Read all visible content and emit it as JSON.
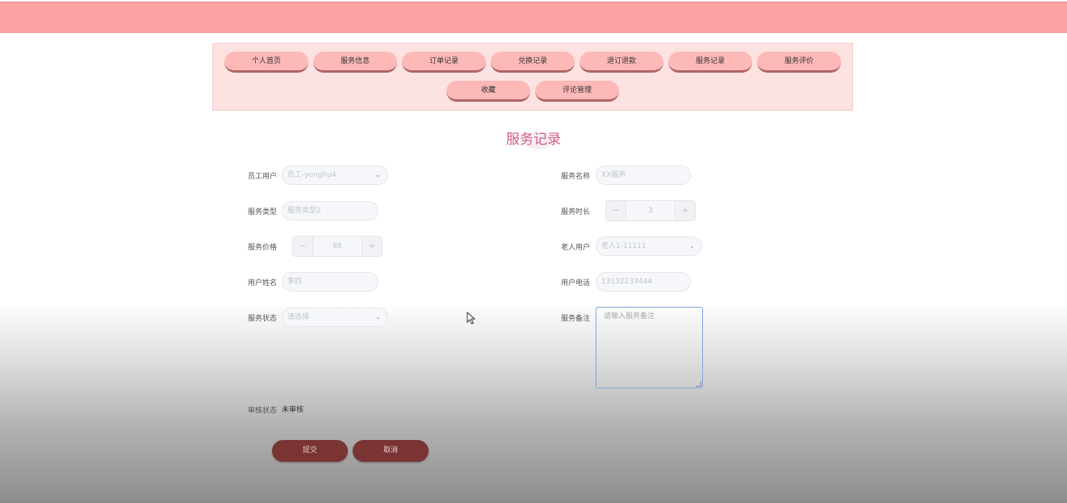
{
  "nav": {
    "items": [
      "个人首页",
      "服务信息",
      "订单记录",
      "兑换记录",
      "退订退款",
      "服务记录",
      "服务评价",
      "收藏",
      "评论管理"
    ]
  },
  "page": {
    "title": "服务记录"
  },
  "form": {
    "employee_user": {
      "label": "员工用户",
      "value": "员工-yonghu4"
    },
    "service_name": {
      "label": "服务名称",
      "placeholder": "XX服务"
    },
    "service_type": {
      "label": "服务类型",
      "placeholder": "服务类型2"
    },
    "service_duration": {
      "label": "服务时长",
      "value": "3",
      "minus": "−",
      "plus": "+"
    },
    "service_price": {
      "label": "服务价格",
      "value": "88",
      "minus": "−",
      "plus": "+"
    },
    "elder_user": {
      "label": "老人用户",
      "value": "老人1-11111"
    },
    "user_name": {
      "label": "用户姓名",
      "placeholder": "李四"
    },
    "user_phone": {
      "label": "用户电话",
      "placeholder": "13132233444"
    },
    "service_status": {
      "label": "服务状态",
      "placeholder": "请选择"
    },
    "service_note": {
      "label": "服务备注",
      "placeholder": "请输入服务备注"
    },
    "review_status": {
      "label": "审核状态",
      "value": "未审核"
    }
  },
  "actions": {
    "submit": "提交",
    "cancel": "取消"
  },
  "icons": {
    "chevron": "chevron-down-icon",
    "cursor": "mouse-pointer-icon"
  },
  "colors": {
    "topbar": "#fba3a3",
    "nav_bg": "#fde2e2",
    "nav_button": "#fcb9b7",
    "title": "#d45b86",
    "action_button": "#7a3434"
  }
}
